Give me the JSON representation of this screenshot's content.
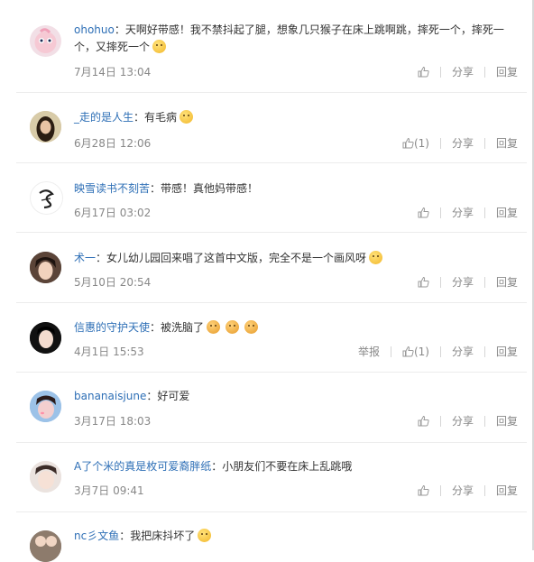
{
  "actions": {
    "reply": "回复",
    "share": "分享",
    "report": "举报"
  },
  "comments": [
    {
      "user": "ohohuo",
      "text": "天啊好带感！我不禁抖起了腿，想象几只猴子在床上跳啊跳，摔死一个，摔死一个，又摔死一个",
      "time": "7月14日 13:04",
      "likes": "",
      "emoji": "laugh-emoji"
    },
    {
      "user": "_走的是人生",
      "text": "有毛病",
      "time": "6月28日 12:06",
      "likes": "(1)",
      "emoji": "surprised-emoji"
    },
    {
      "user": "映雪读书不刻苦",
      "text": "带感！真他妈带感！",
      "time": "6月17日 03:02",
      "likes": ""
    },
    {
      "user": "术一",
      "text": "女儿幼儿园回来唱了这首中文版，完全不是一个画风呀",
      "time": "5月10日 20:54",
      "likes": "",
      "emoji": "tongue-emoji"
    },
    {
      "user": "信惠的守护天使",
      "text": "被洗脑了",
      "time": "4月1日 15:53",
      "likes": "(1)",
      "emoji": "angry-emoji"
    },
    {
      "user": "bananaisjune",
      "text": "好可爱",
      "time": "3月17日 18:03",
      "likes": ""
    },
    {
      "user": "A了个米的真是枚可爱裔胖纸",
      "text": "小朋友们不要在床上乱跳哦",
      "time": "3月7日 09:41",
      "likes": ""
    },
    {
      "user": "nc彡文鱼",
      "text": "我把床抖坏了",
      "time": "",
      "likes": "",
      "emoji": "scared-emoji"
    }
  ]
}
